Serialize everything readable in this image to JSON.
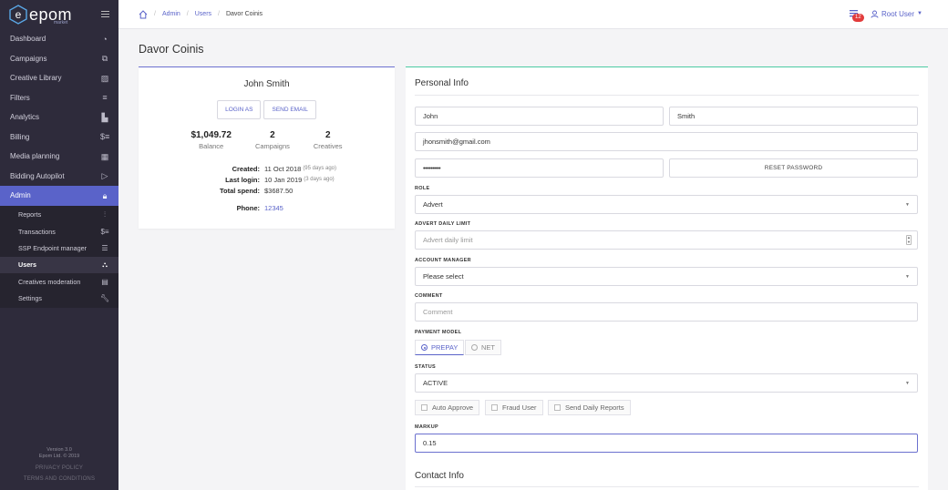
{
  "sidebar": {
    "brand": "epom",
    "brand_sub": "market",
    "items": [
      {
        "label": "Dashboard",
        "icon": "dashboard-icon"
      },
      {
        "label": "Campaigns",
        "icon": "campaigns-icon"
      },
      {
        "label": "Creative Library",
        "icon": "image-icon"
      },
      {
        "label": "Filters",
        "icon": "filter-icon"
      },
      {
        "label": "Analytics",
        "icon": "chart-icon"
      },
      {
        "label": "Billing",
        "icon": "dollar-icon"
      },
      {
        "label": "Media planning",
        "icon": "calendar-icon"
      },
      {
        "label": "Bidding Autopilot",
        "icon": "play-icon"
      },
      {
        "label": "Admin",
        "icon": "lock-icon"
      }
    ],
    "admin_sub": [
      {
        "label": "Reports",
        "icon": "reports-icon"
      },
      {
        "label": "Transactions",
        "icon": "dollar-icon"
      },
      {
        "label": "SSP Endpoint manager",
        "icon": "ssp-icon"
      },
      {
        "label": "Users",
        "icon": "users-icon"
      },
      {
        "label": "Creatives moderation",
        "icon": "moderation-icon"
      },
      {
        "label": "Settings",
        "icon": "wrench-icon"
      }
    ],
    "footer": {
      "version": "Version 3.0",
      "copyright": "Epom Ltd. © 2019",
      "privacy": "PRIVACY POLICY",
      "terms": "TERMS AND CONDITIONS"
    }
  },
  "breadcrumb": {
    "items": [
      "Admin",
      "Users"
    ],
    "current": "Davor Coinis"
  },
  "topbar": {
    "notifications_count": "12",
    "user": "Root User"
  },
  "page_title": "Davor Coinis",
  "profile": {
    "name": "John Smith",
    "login_as": "LOGIN AS",
    "send_email": "SEND EMAIL",
    "stats": [
      {
        "value": "$1,049.72",
        "label": "Balance"
      },
      {
        "value": "2",
        "label": "Campaigns"
      },
      {
        "value": "2",
        "label": "Creatives"
      }
    ],
    "created_label": "Created:",
    "created_value": "11 Oct 2018",
    "created_ago": "(95 days ago)",
    "last_login_label": "Last login:",
    "last_login_value": "10 Jan 2019",
    "last_login_ago": "(3 days ago)",
    "total_spend_label": "Total spend:",
    "total_spend_value": "$3687.50",
    "phone_label": "Phone:",
    "phone_value": "12345"
  },
  "form": {
    "section_title": "Personal Info",
    "first_name": "John",
    "last_name": "Smith",
    "email": "jhonsmith@gmail.com",
    "password_mask": "•••••••••",
    "reset_password": "RESET PASSWORD",
    "role_label": "ROLE",
    "role_value": "Advert",
    "advert_limit_label": "ADVERT DAILY LIMIT",
    "advert_limit_placeholder": "Advert daily limit",
    "account_manager_label": "ACCOUNT MANAGER",
    "account_manager_value": "Please select",
    "comment_label": "COMMENT",
    "comment_placeholder": "Comment",
    "payment_model_label": "PAYMENT MODEL",
    "payment_options": [
      "PREPAY",
      "NET"
    ],
    "payment_selected": "PREPAY",
    "status_label": "STATUS",
    "status_value": "ACTIVE",
    "checkboxes": [
      "Auto Approve",
      "Fraud User",
      "Send Daily Reports"
    ],
    "markup_label": "MARKUP",
    "markup_value": "0.15",
    "contact_title": "Contact Info"
  },
  "colors": {
    "accent": "#5a63c9",
    "sidebar_bg": "#2e2b3b",
    "green_accent": "#4ccaa3",
    "badge": "#e23b3b"
  }
}
